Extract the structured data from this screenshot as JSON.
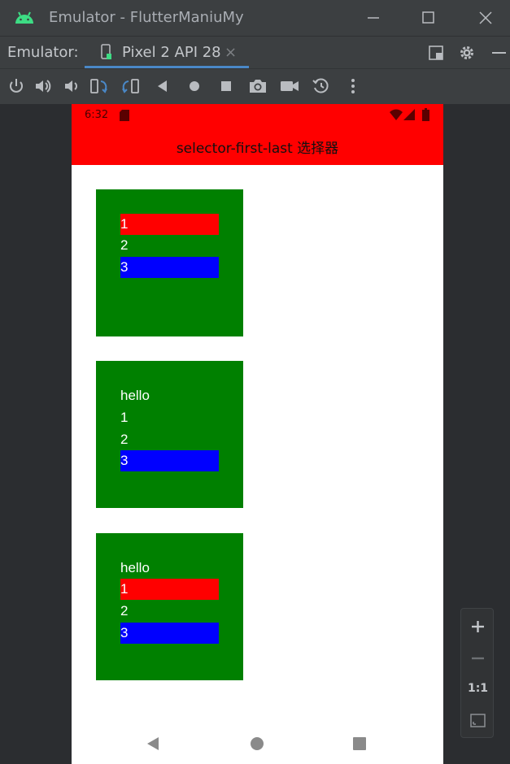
{
  "window": {
    "title": "Emulator - FlutterManiuMy",
    "minimize_icon": "minimize-icon",
    "maximize_icon": "maximize-icon",
    "close_icon": "close-icon"
  },
  "tabbar": {
    "prefix": "Emulator:",
    "tab_label": "Pixel 2 API 28",
    "tab_close": "×",
    "accent": "#4a88c7"
  },
  "toolbar": {
    "icons": [
      "power-icon",
      "volume-up-icon",
      "volume-down-icon",
      "rotate-left-icon",
      "rotate-right-icon",
      "back-icon",
      "home-icon",
      "overview-icon",
      "camera-icon",
      "record-icon",
      "snapshot-icon",
      "more-icon"
    ]
  },
  "device": {
    "status_time": "6:32",
    "app_title": "selector-first-last 选择器",
    "statusbar_color": "#ff0000",
    "box_color": "#008000",
    "boxes": [
      {
        "rows": [
          {
            "text": "1",
            "highlight": "red"
          },
          {
            "text": "2",
            "highlight": "none"
          },
          {
            "text": "3",
            "highlight": "blue"
          }
        ]
      },
      {
        "rows": [
          {
            "text": "hello",
            "highlight": "none"
          },
          {
            "text": "1",
            "highlight": "none"
          },
          {
            "text": "2",
            "highlight": "none"
          },
          {
            "text": "3",
            "highlight": "blue"
          }
        ]
      },
      {
        "rows": [
          {
            "text": "hello",
            "highlight": "none"
          },
          {
            "text": "1",
            "highlight": "red"
          },
          {
            "text": "2",
            "highlight": "none"
          },
          {
            "text": "3",
            "highlight": "blue"
          }
        ]
      }
    ]
  },
  "zoom": {
    "one_to_one": "1:1"
  }
}
